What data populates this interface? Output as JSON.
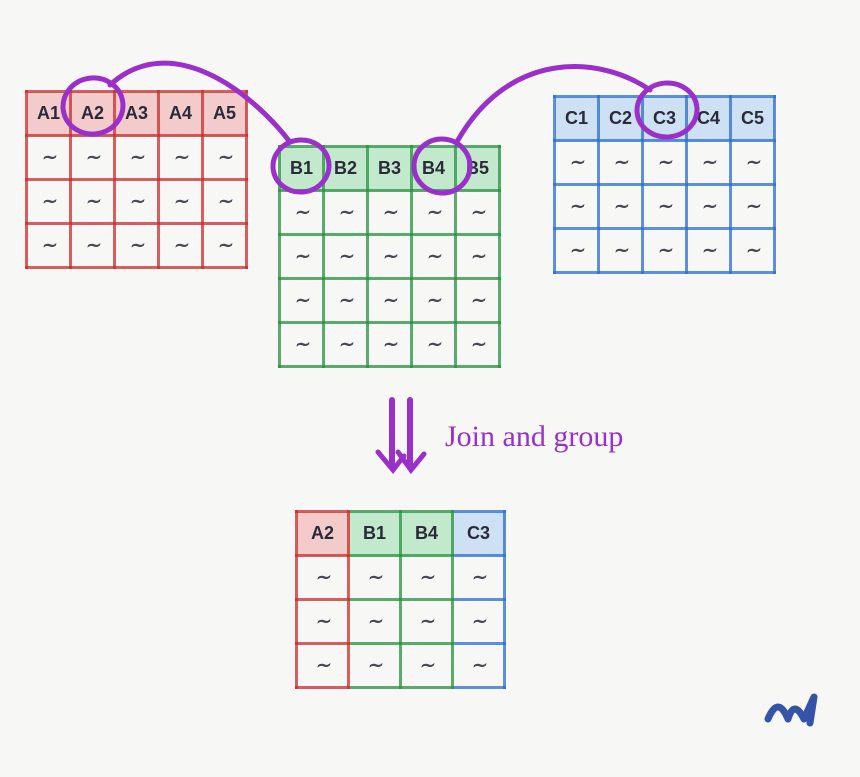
{
  "diagram": {
    "tableA": {
      "color": "red",
      "headers": [
        "A1",
        "A2",
        "A3",
        "A4",
        "A5"
      ],
      "rows": 3,
      "selected_header_index": 1
    },
    "tableB": {
      "color": "green",
      "headers": [
        "B1",
        "B2",
        "B3",
        "B4",
        "B5"
      ],
      "rows": 4,
      "selected_header_indices": [
        0,
        3
      ]
    },
    "tableC": {
      "color": "blue",
      "headers": [
        "C1",
        "C2",
        "C3",
        "C4",
        "C5"
      ],
      "rows": 3,
      "selected_header_index": 2
    },
    "operation_label": "Join and group",
    "result": {
      "columns": [
        {
          "label": "A2",
          "color": "red"
        },
        {
          "label": "B1",
          "color": "green"
        },
        {
          "label": "B4",
          "color": "green"
        },
        {
          "label": "C3",
          "color": "blue"
        }
      ],
      "rows": 3
    },
    "squiggle_glyph": "∼",
    "signature": "✐",
    "colors": {
      "red": "#c92b2b",
      "green": "#24913d",
      "blue": "#296dcc",
      "purple": "#9b2fc9"
    }
  }
}
